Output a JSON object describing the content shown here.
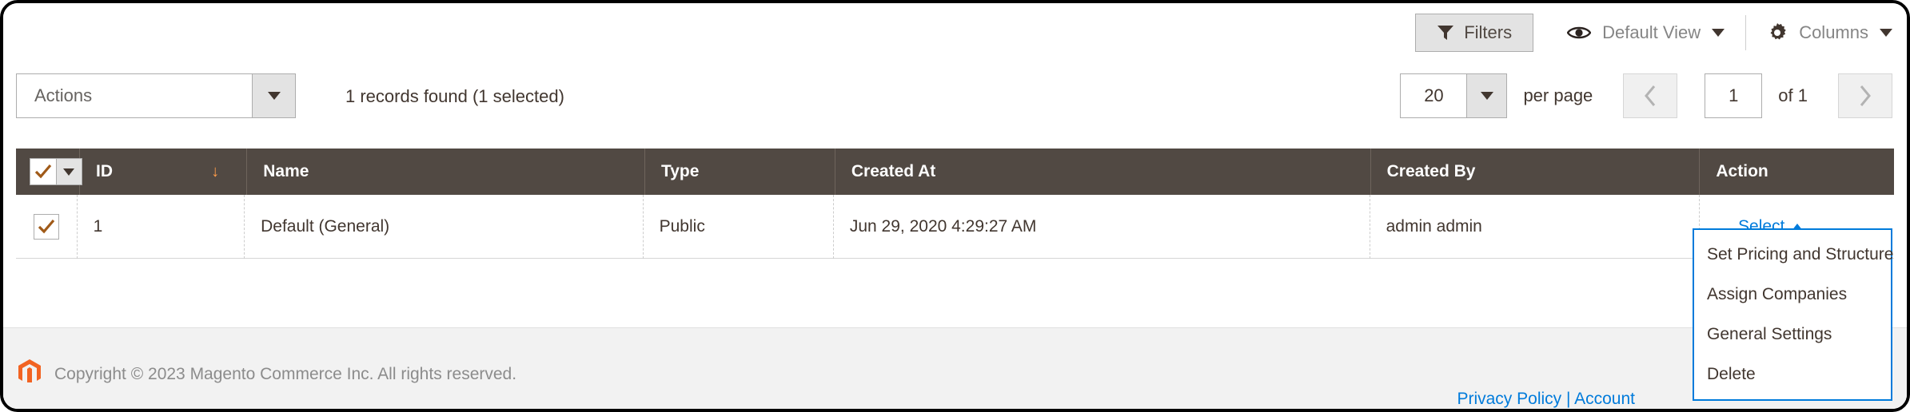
{
  "toolbar": {
    "filters_label": "Filters",
    "filters_icon": "funnel-icon",
    "view_label": "Default View",
    "view_icon": "eye-icon",
    "columns_label": "Columns",
    "columns_icon": "gear-icon"
  },
  "actions": {
    "select_label": "Actions",
    "records_text": "1 records found (1 selected)"
  },
  "pager": {
    "per_page_value": "20",
    "per_page_label": "per page",
    "prev_icon": "chevron-left-icon",
    "next_icon": "chevron-right-icon",
    "page_value": "1",
    "of_text": "of 1"
  },
  "grid": {
    "columns": [
      {
        "key": "check",
        "label": ""
      },
      {
        "key": "id",
        "label": "ID",
        "sort": "↓"
      },
      {
        "key": "name",
        "label": "Name"
      },
      {
        "key": "type",
        "label": "Type"
      },
      {
        "key": "created_at",
        "label": "Created At"
      },
      {
        "key": "created_by",
        "label": "Created By"
      },
      {
        "key": "action",
        "label": "Action"
      }
    ],
    "rows": [
      {
        "id": "1",
        "name": "Default (General)",
        "type": "Public",
        "created_at": "Jun 29, 2020 4:29:27 AM",
        "created_by": "admin admin",
        "action_label": "Select",
        "checked": true
      }
    ]
  },
  "action_menu": {
    "items": [
      {
        "label": "Set Pricing and Structure"
      },
      {
        "label": "Assign Companies"
      },
      {
        "label": "General Settings"
      },
      {
        "label": "Delete"
      }
    ]
  },
  "footer": {
    "copyright": "Copyright © 2023 Magento Commerce Inc. All rights reserved.",
    "logo_icon": "magento-logo-icon",
    "links": "Privacy Policy | Account"
  },
  "colors": {
    "header_bg": "#514943",
    "accent_link": "#007bdb",
    "accent_orange": "#eb5202",
    "sort_arrow": "#ff9d4a"
  }
}
